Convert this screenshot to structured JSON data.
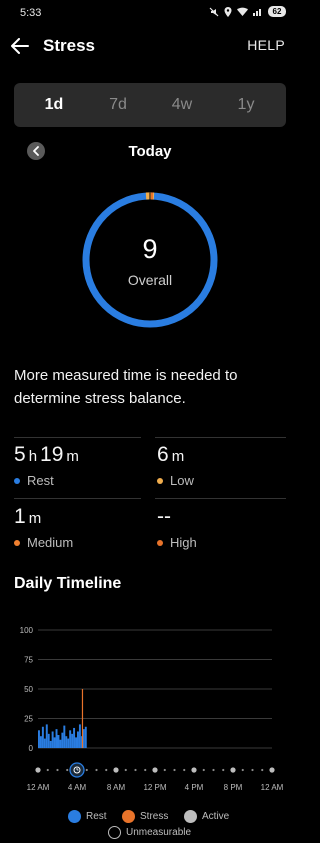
{
  "status_bar": {
    "time": "5:33",
    "battery": "62"
  },
  "header": {
    "title": "Stress",
    "help_label": "HELP"
  },
  "period_tabs": [
    {
      "label": "1d",
      "active": true
    },
    {
      "label": "7d",
      "active": false
    },
    {
      "label": "4w",
      "active": false
    },
    {
      "label": "1y",
      "active": false
    }
  ],
  "date_label": "Today",
  "summary": {
    "score": "9",
    "score_label": "Overall"
  },
  "notice": "More measured time is needed to determine stress balance.",
  "stats": [
    {
      "value_parts": [
        "5",
        "h",
        "19",
        "m"
      ],
      "label": "Rest",
      "color": "#2a7de1"
    },
    {
      "value_parts": [
        "6",
        "m"
      ],
      "label": "Low",
      "color": "#f0ad4e"
    },
    {
      "value_parts": [
        "1",
        "m"
      ],
      "label": "Medium",
      "color": "#f08030"
    },
    {
      "value_parts": [
        "--"
      ],
      "label": "High",
      "color": "#e8732a"
    }
  ],
  "timeline": {
    "title": "Daily Timeline"
  },
  "chart_data": {
    "type": "bar",
    "ylim": [
      0,
      100
    ],
    "yticks": [
      "100",
      "75",
      "50",
      "25",
      "0"
    ],
    "xticks": [
      "12 AM",
      "4 AM",
      "8 AM",
      "12 PM",
      "4 PM",
      "8 PM",
      "12 AM"
    ],
    "series": [
      {
        "name": "Rest",
        "color": "#2a7de1",
        "x": [
          0.0,
          0.2,
          0.4,
          0.6,
          0.8,
          1.0,
          1.2,
          1.4,
          1.6,
          1.8,
          2.0,
          2.2,
          2.4,
          2.6,
          2.8,
          3.0,
          3.2,
          3.4,
          3.6,
          3.8,
          4.0,
          4.2,
          4.4,
          4.6,
          4.8
        ],
        "values": [
          15,
          10,
          18,
          8,
          20,
          12,
          6,
          14,
          9,
          16,
          11,
          7,
          13,
          19,
          10,
          8,
          15,
          12,
          17,
          9,
          14,
          20,
          10,
          16,
          18
        ]
      },
      {
        "name": "Stress",
        "color": "#e8732a",
        "x": [
          4.5
        ],
        "values": [
          50
        ]
      }
    ],
    "legend": [
      "Rest",
      "Stress",
      "Active",
      "Unmeasurable"
    ],
    "legend_colors": [
      "#2a7de1",
      "#e8732a",
      "#bdbdbd",
      "#000000"
    ]
  }
}
